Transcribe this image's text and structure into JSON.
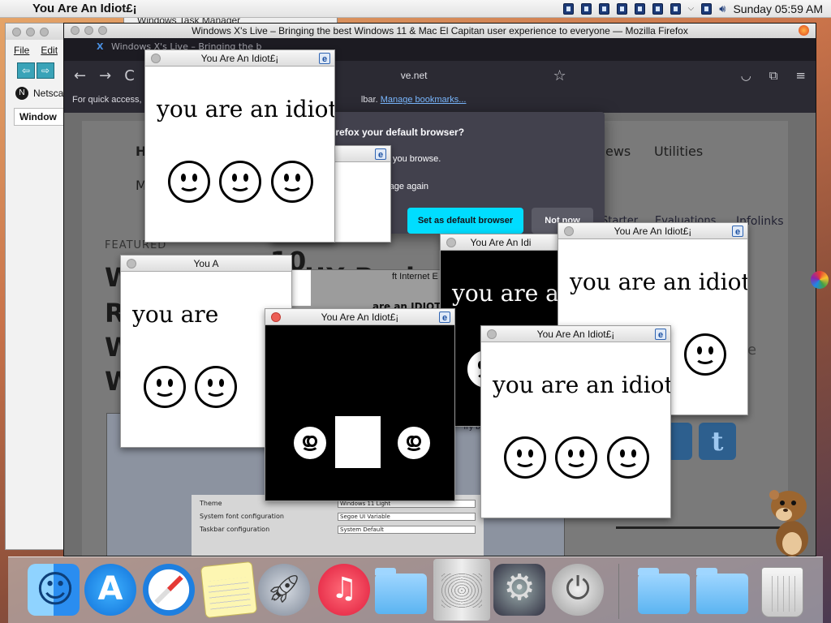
{
  "menubar": {
    "app_title": "You Are An Idiot£¡",
    "clock": "Sunday 05:59 AM",
    "tray_icons": [
      "window-icon",
      "window-icon",
      "window-icon",
      "window-icon",
      "window-icon",
      "window-icon",
      "window-icon"
    ]
  },
  "task_manager": {
    "title": "Windows Task Manager"
  },
  "netscape": {
    "menu": [
      "File",
      "Edit"
    ],
    "bookmark": "Netscap",
    "tab": "Window"
  },
  "firefox": {
    "window_title": "Windows X's Live – Bringing the best Windows 11 & Mac El Capitan user experience to everyone — Mozilla Firefox",
    "tab_title": "Windows X's Live – Bringing the b",
    "url_fragment": "ve.net",
    "bookmarks_text": "For quick access, p",
    "bookmarks_text_tail": "lbar.",
    "bookmarks_link": "Manage bookmarks...",
    "site_nav": [
      "H",
      "ews",
      "Utilities"
    ],
    "site_nav_m": "M",
    "featured_label": "FEATURED",
    "headline_fragments": [
      "ws 10",
      "UX Pack",
      "W",
      "R",
      "W",
      "W"
    ],
    "side_links": [
      "Starter",
      "Evaluations",
      "Infolinks"
    ],
    "side_letter_e": "e",
    "dialog": {
      "question": "irefox your default browser?",
      "text": "acy every time you browse.",
      "checkbox": "how this message again",
      "primary": "Set as default browser",
      "secondary": "Not now"
    },
    "ie_fragment": "ft Internet E",
    "idiot_fragment": "are an IDIOT",
    "screenshot_settings": [
      {
        "label": "Theme",
        "value": "Windows 11 Light"
      },
      {
        "label": "System font configuration",
        "value": "Segoe UI Variable"
      },
      {
        "label": "Taskbar configuration",
        "value": "System Default"
      }
    ],
    "try_text": "Try bu"
  },
  "popups": [
    {
      "title": "You Are An Idiot£¡",
      "message": "you are an idiot"
    },
    {
      "title": "",
      "message": ""
    },
    {
      "title": "You A",
      "message": "you are"
    },
    {
      "title": "You Are An Idi",
      "message": "you are an"
    },
    {
      "title": "You Are An Idiot£¡",
      "message": "you are an idiot"
    },
    {
      "title": "You Are An Idiot£¡",
      "message": ""
    },
    {
      "title": "You Are An Idiot£¡",
      "message": "you are an idiot"
    }
  ],
  "dock": {
    "items": [
      "finder-icon",
      "app-store-icon",
      "safari-icon",
      "notes-icon",
      "launchpad-icon",
      "itunes-icon",
      "applications-folder-icon",
      "mac-pro-icon",
      "system-preferences-icon",
      "shutdown-icon",
      "documents-folder-icon",
      "downloads-folder-icon",
      "trash-icon"
    ]
  },
  "colors": {
    "dialog_bg": "#42414d",
    "primary_button": "#00ddff",
    "popup_dark_bg": "#000000",
    "link": "#7ab8ff"
  }
}
